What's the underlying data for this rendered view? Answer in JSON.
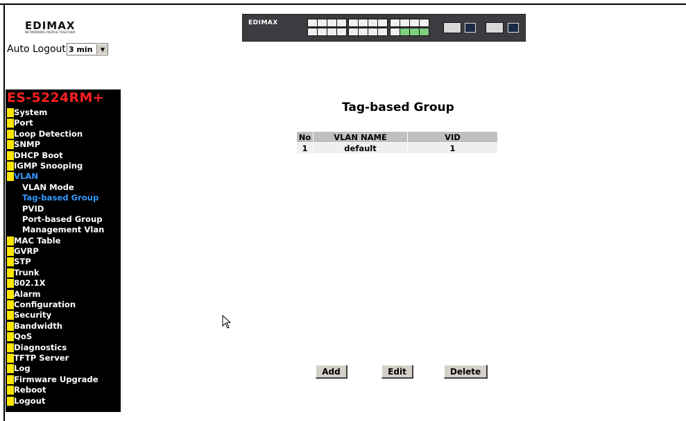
{
  "header": {
    "logo_text": "EDIMAX",
    "logo_tagline": "NETWORKING PEOPLE TOGETHER",
    "device_brand": "EDIMAX",
    "auto_logout_label": "Auto Logout",
    "auto_logout_value": "3 min"
  },
  "sidebar": {
    "model": "ES-5224RM+",
    "items": [
      {
        "label": "System",
        "sub": false,
        "active": false
      },
      {
        "label": "Port",
        "sub": false,
        "active": false
      },
      {
        "label": "Loop Detection",
        "sub": false,
        "active": false
      },
      {
        "label": "SNMP",
        "sub": false,
        "active": false
      },
      {
        "label": "DHCP Boot",
        "sub": false,
        "active": false
      },
      {
        "label": "IGMP Snooping",
        "sub": false,
        "active": false
      },
      {
        "label": "VLAN",
        "sub": false,
        "active": true
      },
      {
        "label": "VLAN Mode",
        "sub": true,
        "active": false
      },
      {
        "label": "Tag-based Group",
        "sub": true,
        "active": true
      },
      {
        "label": "PVID",
        "sub": true,
        "active": false
      },
      {
        "label": "Port-based Group",
        "sub": true,
        "active": false
      },
      {
        "label": "Management Vlan",
        "sub": true,
        "active": false
      },
      {
        "label": "MAC Table",
        "sub": false,
        "active": false
      },
      {
        "label": "GVRP",
        "sub": false,
        "active": false
      },
      {
        "label": "STP",
        "sub": false,
        "active": false
      },
      {
        "label": "Trunk",
        "sub": false,
        "active": false
      },
      {
        "label": "802.1X",
        "sub": false,
        "active": false
      },
      {
        "label": "Alarm",
        "sub": false,
        "active": false
      },
      {
        "label": "Configuration",
        "sub": false,
        "active": false
      },
      {
        "label": "Security",
        "sub": false,
        "active": false
      },
      {
        "label": "Bandwidth",
        "sub": false,
        "active": false
      },
      {
        "label": "QoS",
        "sub": false,
        "active": false
      },
      {
        "label": "Diagnostics",
        "sub": false,
        "active": false
      },
      {
        "label": "TFTP Server",
        "sub": false,
        "active": false
      },
      {
        "label": "Log",
        "sub": false,
        "active": false
      },
      {
        "label": "Firmware Upgrade",
        "sub": false,
        "active": false
      },
      {
        "label": "Reboot",
        "sub": false,
        "active": false
      },
      {
        "label": "Logout",
        "sub": false,
        "active": false
      }
    ]
  },
  "main": {
    "title": "Tag-based Group",
    "table": {
      "headers": [
        "No",
        "VLAN NAME",
        "VID"
      ],
      "rows": [
        [
          "1",
          "default",
          "1"
        ]
      ]
    },
    "buttons": {
      "add": "Add",
      "edit": "Edit",
      "delete": "Delete"
    }
  },
  "colors": {
    "sidebar_bg": "#000000",
    "model_red": "#ff2020",
    "bullet_yellow": "#ffe600",
    "active_blue": "#3399ff",
    "table_header": "#c0c0c0",
    "table_row": "#efefef"
  }
}
